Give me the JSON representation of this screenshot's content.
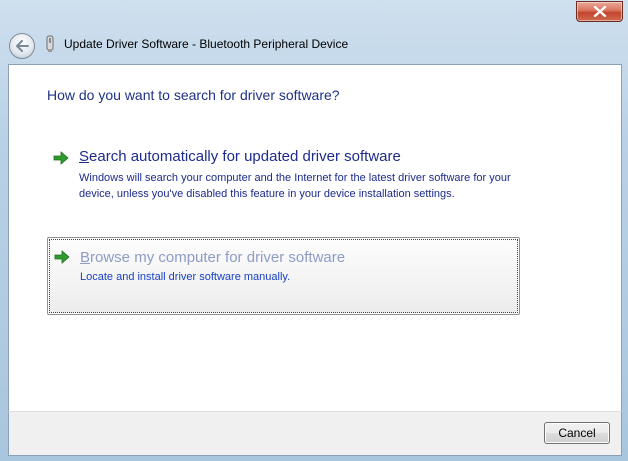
{
  "window": {
    "title": "Update Driver Software - Bluetooth Peripheral Device",
    "close_icon": "close-icon",
    "back_icon": "back-arrow-icon",
    "device_icon": "bluetooth-device-icon"
  },
  "main": {
    "question": "How do you want to search for driver software?",
    "options": [
      {
        "title_first": "S",
        "title_rest": "earch automatically for updated driver software",
        "description": "Windows will search your computer and the Internet for the latest driver software for your device, unless you've disabled this feature in your device installation settings.",
        "icon": "green-arrow-icon"
      },
      {
        "title_first": "B",
        "title_rest": "rowse my computer for driver software",
        "description": "Locate and install driver software manually.",
        "icon": "green-arrow-icon",
        "state": "hover"
      }
    ]
  },
  "footer": {
    "cancel_label": "Cancel"
  },
  "colors": {
    "title_blue": "#1e3287",
    "link_blue": "#1a40c8",
    "arrow_green": "#2e9b2e",
    "close_red": "#c2452c"
  }
}
